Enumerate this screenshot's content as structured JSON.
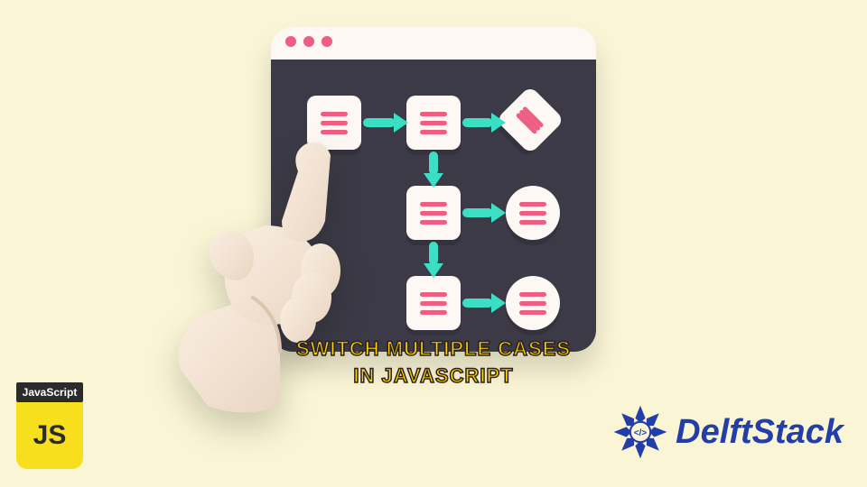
{
  "caption": {
    "line1": "Switch Multiple Cases",
    "line2": "in Javascript"
  },
  "js_badge": {
    "label": "JavaScript",
    "letters": "JS"
  },
  "brand": {
    "name": "DelftStack"
  },
  "colors": {
    "bg": "#faf5d5",
    "window_body": "#3b3a46",
    "window_header": "#fdf8f4",
    "accent_pink": "#ed5e82",
    "arrow_teal": "#3be0c4",
    "caption_fill": "#ffd400",
    "js_yellow": "#f7df1e",
    "brand_blue": "#233ea8"
  },
  "flowchart": {
    "nodes": [
      {
        "id": "n1",
        "shape": "square"
      },
      {
        "id": "n2",
        "shape": "square"
      },
      {
        "id": "n3",
        "shape": "diamond"
      },
      {
        "id": "n4",
        "shape": "square"
      },
      {
        "id": "n5",
        "shape": "circle"
      },
      {
        "id": "n6",
        "shape": "square"
      },
      {
        "id": "n7",
        "shape": "circle"
      }
    ],
    "arrows": [
      {
        "from": "n1",
        "to": "n2",
        "dir": "right"
      },
      {
        "from": "n2",
        "to": "n3",
        "dir": "right"
      },
      {
        "from": "n2",
        "to": "n4",
        "dir": "down"
      },
      {
        "from": "n4",
        "to": "n5",
        "dir": "right"
      },
      {
        "from": "n4",
        "to": "n6",
        "dir": "down"
      },
      {
        "from": "n6",
        "to": "n7",
        "dir": "right"
      }
    ]
  }
}
